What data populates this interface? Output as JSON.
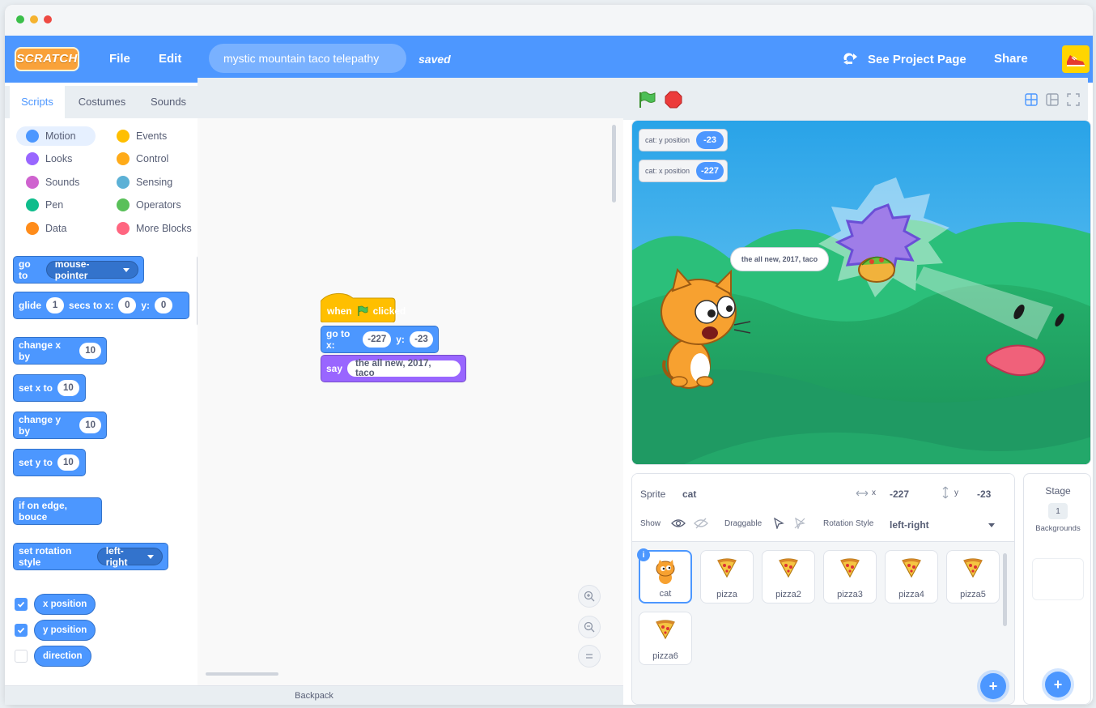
{
  "app": {
    "logo_text": "SCRATCH",
    "menu": {
      "file": "File",
      "edit": "Edit"
    },
    "project_title": "mystic mountain taco telepathy",
    "save_status": "saved",
    "see_project_page": "See Project Page",
    "share": "Share"
  },
  "palette": {
    "tabs": [
      {
        "label": "Scripts",
        "active": true
      },
      {
        "label": "Costumes",
        "active": false
      },
      {
        "label": "Sounds",
        "active": false
      }
    ],
    "categories": [
      {
        "label": "Motion",
        "color": "#4c97ff"
      },
      {
        "label": "Events",
        "color": "#ffbf00"
      },
      {
        "label": "Looks",
        "color": "#9966ff"
      },
      {
        "label": "Control",
        "color": "#ffab19"
      },
      {
        "label": "Sounds",
        "color": "#cf63cf"
      },
      {
        "label": "Sensing",
        "color": "#5cb1d6"
      },
      {
        "label": "Pen",
        "color": "#0fbd8c"
      },
      {
        "label": "Operators",
        "color": "#59c059"
      },
      {
        "label": "Data",
        "color": "#ff8c1a"
      },
      {
        "label": "More Blocks",
        "color": "#ff6680"
      }
    ],
    "blocks": {
      "go_to": {
        "label": "go to",
        "dropdown": "mouse-pointer"
      },
      "glide": {
        "label1": "glide",
        "secs": "1",
        "label2": "secs to x:",
        "x": "0",
        "label3": "y:",
        "y": "0"
      },
      "change_x": {
        "label": "change x by",
        "value": "10"
      },
      "set_x": {
        "label": "set x to",
        "value": "10"
      },
      "change_y": {
        "label": "change y by",
        "value": "10"
      },
      "set_y": {
        "label": "set y to",
        "value": "10"
      },
      "bounce": {
        "label": "if on edge, bouce"
      },
      "rotation": {
        "label": "set rotation style",
        "dropdown": "left-right"
      }
    },
    "reporters": [
      {
        "label": "x position",
        "checked": true
      },
      {
        "label": "y position",
        "checked": true
      },
      {
        "label": "direction",
        "checked": false
      }
    ]
  },
  "script": {
    "hat": {
      "label1": "when",
      "label2": "clicked"
    },
    "goto": {
      "label": "go to x:",
      "x": "-227",
      "ylabel": "y:",
      "y": "-23"
    },
    "say": {
      "label": "say",
      "text": "the all new, 2017, taco"
    }
  },
  "stage": {
    "monitors": [
      {
        "label": "cat: y position",
        "value": "-23"
      },
      {
        "label": "cat: x position",
        "value": "-227"
      }
    ],
    "speech": "the all new, 2017, taco"
  },
  "sprite_info": {
    "sprite_label": "Sprite",
    "sprite_name": "cat",
    "x_label": "x",
    "x_value": "-227",
    "y_label": "y",
    "y_value": "-23",
    "show_label": "Show",
    "draggable_label": "Draggable",
    "rotation_label": "Rotation Style",
    "rotation_value": "left-right"
  },
  "sprites": [
    {
      "name": "cat",
      "selected": true
    },
    {
      "name": "pizza",
      "selected": false
    },
    {
      "name": "pizza2",
      "selected": false
    },
    {
      "name": "pizza3",
      "selected": false
    },
    {
      "name": "pizza4",
      "selected": false
    },
    {
      "name": "pizza5",
      "selected": false
    },
    {
      "name": "pizza6",
      "selected": false
    }
  ],
  "stage_pane": {
    "title": "Stage",
    "count": "1",
    "backgrounds_label": "Backgrounds"
  },
  "backpack": "Backpack",
  "colors": {
    "menubar": "#4d97ff",
    "motion": "#4c97ff",
    "events": "#ffbf00",
    "looks": "#9966ff"
  }
}
